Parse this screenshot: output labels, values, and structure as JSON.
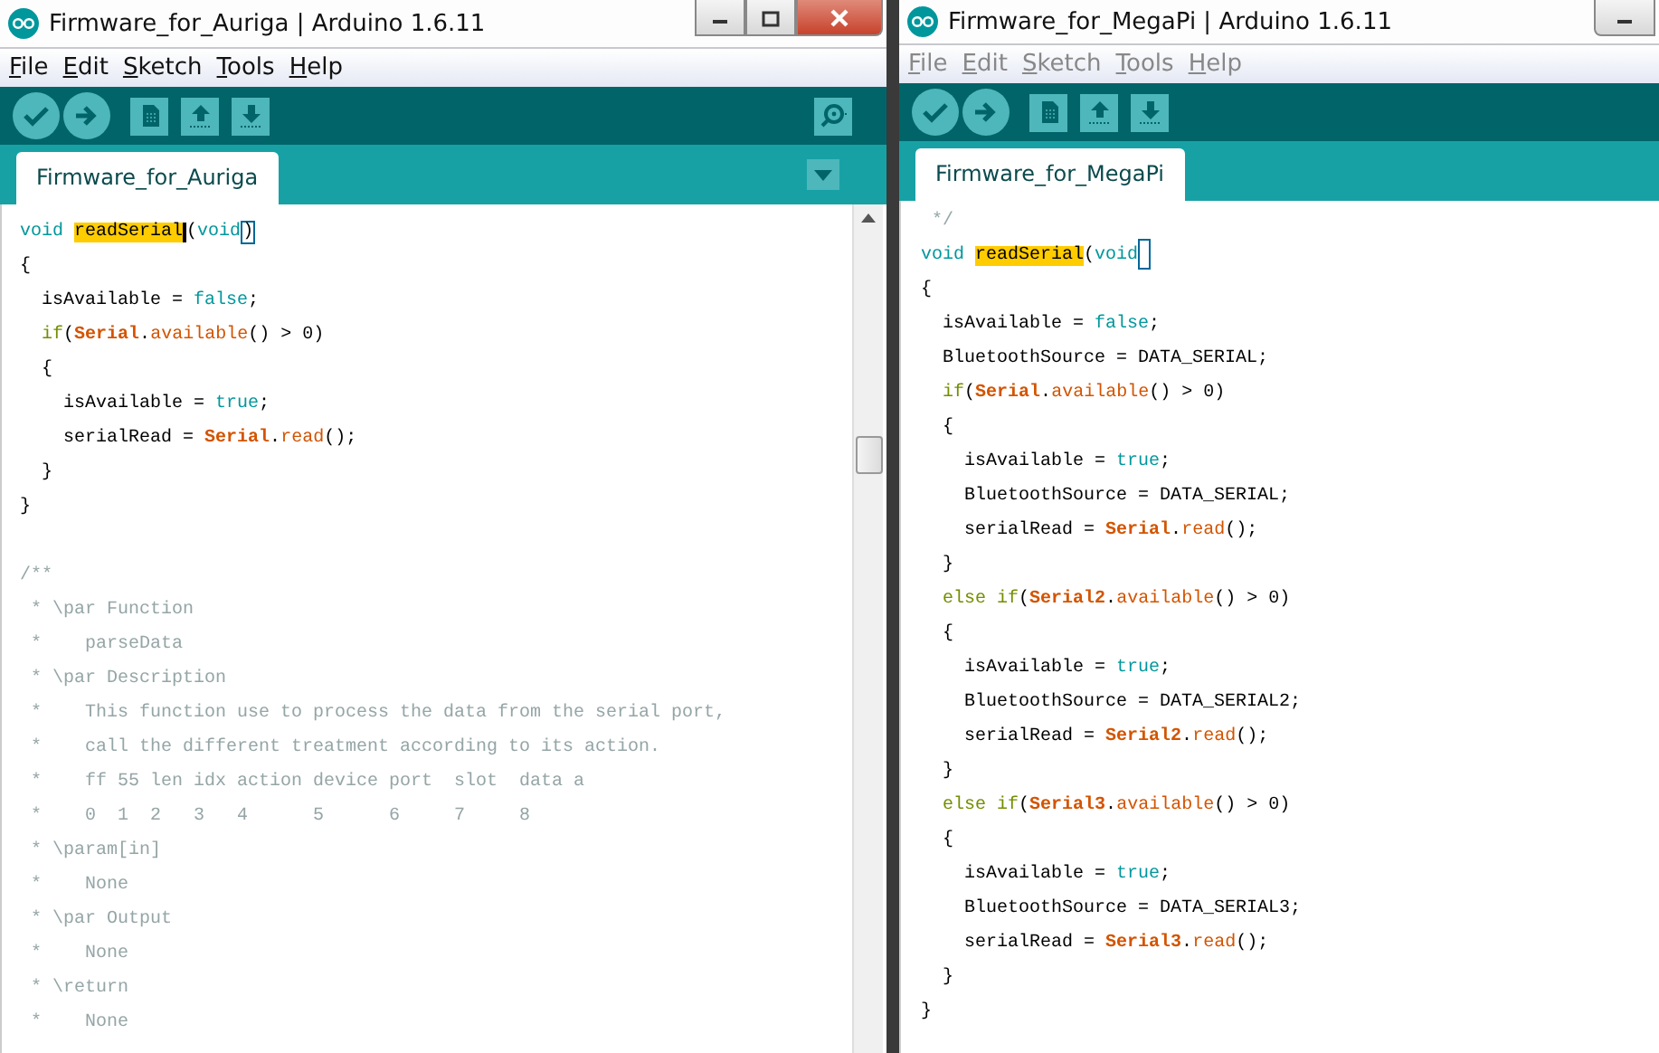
{
  "windows": [
    {
      "title": "Firmware_for_Auriga | Arduino 1.6.11",
      "active": true,
      "window_buttons": [
        {
          "kind": "minimize"
        },
        {
          "kind": "maximize"
        },
        {
          "kind": "close"
        }
      ],
      "menu": [
        "File",
        "Edit",
        "Sketch",
        "Tools",
        "Help"
      ],
      "serial_monitor": true,
      "tab_menu": true,
      "scrollbar": true,
      "tab": {
        "label": "Firmware_for_Auriga",
        "selected": true
      },
      "code": [
        {
          "tokens": [
            {
              "text": "void ",
              "kind": "type"
            },
            {
              "text": "readSerial",
              "kind": "highlight_caret"
            },
            {
              "text": "(",
              "kind": "plain"
            },
            {
              "text": "void",
              "kind": "type"
            },
            {
              "text": ")",
              "kind": "match"
            }
          ]
        },
        {
          "tokens": [
            {
              "text": "{",
              "kind": "plain"
            }
          ]
        },
        {
          "tokens": [
            {
              "text": "  isAvailable = ",
              "kind": "plain"
            },
            {
              "text": "false",
              "kind": "type"
            },
            {
              "text": ";",
              "kind": "plain"
            }
          ]
        },
        {
          "tokens": [
            {
              "text": "  if",
              "kind": "keyword"
            },
            {
              "text": "(",
              "kind": "plain"
            },
            {
              "text": "Serial",
              "kind": "serial"
            },
            {
              "text": ".",
              "kind": "plain"
            },
            {
              "text": "available",
              "kind": "func"
            },
            {
              "text": "() > 0)",
              "kind": "plain"
            }
          ]
        },
        {
          "tokens": [
            {
              "text": "  {",
              "kind": "plain"
            }
          ]
        },
        {
          "tokens": [
            {
              "text": "    isAvailable = ",
              "kind": "plain"
            },
            {
              "text": "true",
              "kind": "type"
            },
            {
              "text": ";",
              "kind": "plain"
            }
          ]
        },
        {
          "tokens": [
            {
              "text": "    serialRead = ",
              "kind": "plain"
            },
            {
              "text": "Serial",
              "kind": "serial"
            },
            {
              "text": ".",
              "kind": "plain"
            },
            {
              "text": "read",
              "kind": "func"
            },
            {
              "text": "();",
              "kind": "plain"
            }
          ]
        },
        {
          "tokens": [
            {
              "text": "  }",
              "kind": "plain"
            }
          ]
        },
        {
          "tokens": [
            {
              "text": "}",
              "kind": "plain"
            }
          ]
        },
        {
          "kind": "blank"
        },
        {
          "tokens": [
            {
              "text": "/**",
              "kind": "comment"
            }
          ]
        },
        {
          "tokens": [
            {
              "text": " * \\par Function",
              "kind": "comment"
            }
          ]
        },
        {
          "tokens": [
            {
              "text": " *    parseData",
              "kind": "comment"
            }
          ]
        },
        {
          "tokens": [
            {
              "text": " * \\par Description",
              "kind": "comment"
            }
          ]
        },
        {
          "tokens": [
            {
              "text": " *    This function use to process the data from the serial port,",
              "kind": "comment"
            }
          ]
        },
        {
          "tokens": [
            {
              "text": " *    call the different treatment according to its action.",
              "kind": "comment"
            }
          ]
        },
        {
          "tokens": [
            {
              "text": " *    ff 55 len idx action device port  slot  data a",
              "kind": "comment"
            }
          ]
        },
        {
          "tokens": [
            {
              "text": " *    0  1  2   3   4      5      6     7     8",
              "kind": "comment"
            }
          ]
        },
        {
          "tokens": [
            {
              "text": " * \\param[in]",
              "kind": "comment"
            }
          ]
        },
        {
          "tokens": [
            {
              "text": " *    None",
              "kind": "comment"
            }
          ]
        },
        {
          "tokens": [
            {
              "text": " * \\par Output",
              "kind": "comment"
            }
          ]
        },
        {
          "tokens": [
            {
              "text": " *    None",
              "kind": "comment"
            }
          ]
        },
        {
          "tokens": [
            {
              "text": " * \\return",
              "kind": "comment"
            }
          ]
        },
        {
          "tokens": [
            {
              "text": " *    None",
              "kind": "comment"
            }
          ]
        }
      ]
    },
    {
      "title": "Firmware_for_MegaPi | Arduino 1.6.11",
      "active": false,
      "window_buttons": [
        {
          "kind": "minimize"
        }
      ],
      "menu": [
        "File",
        "Edit",
        "Sketch",
        "Tools",
        "Help"
      ],
      "serial_monitor": false,
      "tab_menu": false,
      "scrollbar": false,
      "tab": {
        "label": "Firmware_for_MegaPi",
        "selected": true
      },
      "code": [
        {
          "tokens": [
            {
              "text": " */",
              "kind": "comment"
            }
          ]
        },
        {
          "cursor_box": true,
          "tokens": [
            {
              "text": "void ",
              "kind": "type"
            },
            {
              "text": "readSerial",
              "kind": "highlight"
            },
            {
              "text": "(",
              "kind": "plain"
            },
            {
              "text": "void",
              "kind": "type"
            }
          ]
        },
        {
          "tokens": [
            {
              "text": "{",
              "kind": "plain"
            }
          ]
        },
        {
          "tokens": [
            {
              "text": "  isAvailable = ",
              "kind": "plain"
            },
            {
              "text": "false",
              "kind": "type"
            },
            {
              "text": ";",
              "kind": "plain"
            }
          ]
        },
        {
          "tokens": [
            {
              "text": "  BluetoothSource = DATA_SERIAL;",
              "kind": "plain"
            }
          ]
        },
        {
          "tokens": [
            {
              "text": "  if",
              "kind": "keyword"
            },
            {
              "text": "(",
              "kind": "plain"
            },
            {
              "text": "Serial",
              "kind": "serial"
            },
            {
              "text": ".",
              "kind": "plain"
            },
            {
              "text": "available",
              "kind": "func"
            },
            {
              "text": "() > 0)",
              "kind": "plain"
            }
          ]
        },
        {
          "tokens": [
            {
              "text": "  {",
              "kind": "plain"
            }
          ]
        },
        {
          "tokens": [
            {
              "text": "    isAvailable = ",
              "kind": "plain"
            },
            {
              "text": "true",
              "kind": "type"
            },
            {
              "text": ";",
              "kind": "plain"
            }
          ]
        },
        {
          "tokens": [
            {
              "text": "    BluetoothSource = DATA_SERIAL;",
              "kind": "plain"
            }
          ]
        },
        {
          "tokens": [
            {
              "text": "    serialRead = ",
              "kind": "plain"
            },
            {
              "text": "Serial",
              "kind": "serial"
            },
            {
              "text": ".",
              "kind": "plain"
            },
            {
              "text": "read",
              "kind": "func"
            },
            {
              "text": "();",
              "kind": "plain"
            }
          ]
        },
        {
          "tokens": [
            {
              "text": "  }",
              "kind": "plain"
            }
          ]
        },
        {
          "tokens": [
            {
              "text": "  else if",
              "kind": "keyword"
            },
            {
              "text": "(",
              "kind": "plain"
            },
            {
              "text": "Serial2",
              "kind": "serial"
            },
            {
              "text": ".",
              "kind": "plain"
            },
            {
              "text": "available",
              "kind": "func"
            },
            {
              "text": "() > 0)",
              "kind": "plain"
            }
          ]
        },
        {
          "tokens": [
            {
              "text": "  {",
              "kind": "plain"
            }
          ]
        },
        {
          "tokens": [
            {
              "text": "    isAvailable = ",
              "kind": "plain"
            },
            {
              "text": "true",
              "kind": "type"
            },
            {
              "text": ";",
              "kind": "plain"
            }
          ]
        },
        {
          "tokens": [
            {
              "text": "    BluetoothSource = DATA_SERIAL2;",
              "kind": "plain"
            }
          ]
        },
        {
          "tokens": [
            {
              "text": "    serialRead = ",
              "kind": "plain"
            },
            {
              "text": "Serial2",
              "kind": "serial"
            },
            {
              "text": ".",
              "kind": "plain"
            },
            {
              "text": "read",
              "kind": "func"
            },
            {
              "text": "();",
              "kind": "plain"
            }
          ]
        },
        {
          "tokens": [
            {
              "text": "  }",
              "kind": "plain"
            }
          ]
        },
        {
          "tokens": [
            {
              "text": "  else if",
              "kind": "keyword"
            },
            {
              "text": "(",
              "kind": "plain"
            },
            {
              "text": "Serial3",
              "kind": "serial"
            },
            {
              "text": ".",
              "kind": "plain"
            },
            {
              "text": "available",
              "kind": "func"
            },
            {
              "text": "() > 0)",
              "kind": "plain"
            }
          ]
        },
        {
          "tokens": [
            {
              "text": "  {",
              "kind": "plain"
            }
          ]
        },
        {
          "tokens": [
            {
              "text": "    isAvailable = ",
              "kind": "plain"
            },
            {
              "text": "true",
              "kind": "type"
            },
            {
              "text": ";",
              "kind": "plain"
            }
          ]
        },
        {
          "tokens": [
            {
              "text": "    BluetoothSource = DATA_SERIAL3;",
              "kind": "plain"
            }
          ]
        },
        {
          "tokens": [
            {
              "text": "    serialRead = ",
              "kind": "plain"
            },
            {
              "text": "Serial3",
              "kind": "serial"
            },
            {
              "text": ".",
              "kind": "plain"
            },
            {
              "text": "read",
              "kind": "func"
            },
            {
              "text": "();",
              "kind": "plain"
            }
          ]
        },
        {
          "tokens": [
            {
              "text": "  }",
              "kind": "plain"
            }
          ]
        },
        {
          "tokens": [
            {
              "text": "}",
              "kind": "plain"
            }
          ]
        }
      ]
    }
  ]
}
